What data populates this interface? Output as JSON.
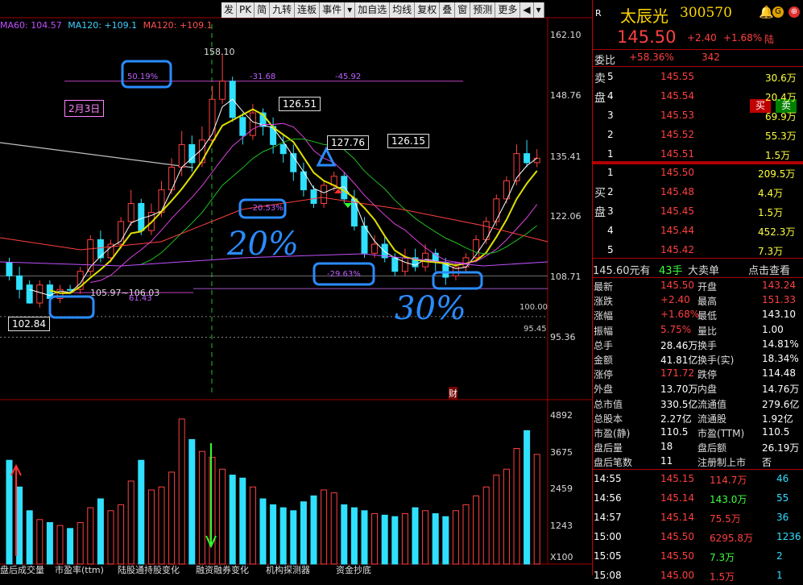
{
  "toolbar": {
    "items": [
      "发",
      "PK",
      "简",
      "九转",
      "连板",
      "事件",
      "▾",
      "加自选",
      "均线",
      "复权",
      "叠",
      "窗",
      "预测",
      "更多",
      "◀",
      "▾"
    ]
  },
  "ma_line": {
    "ma60": "MA60: 104.57",
    "ma120a": "MA120: +109.1",
    "ma120b": "MA120: +109.1"
  },
  "price_axis": [
    "162.10",
    "148.76",
    "135.41",
    "122.06",
    "108.71",
    "95.36"
  ],
  "vol_axis": [
    "4892",
    "3675",
    "2459",
    "1243",
    "X100"
  ],
  "levels": {
    "l100": "100.00",
    "l9545": "95.45"
  },
  "annotations": {
    "feb3": "2月3日",
    "p12651": "126.51",
    "p12776": "127.76",
    "p12615": "126.15",
    "p10284": "102.84",
    "p15810": "158.10",
    "range": "105.97~106.03",
    "pct5019": "50.19%",
    "pct2053": "-20.53%",
    "pct2963": "-29.63%",
    "pct3168": "-31.68",
    "pct4592": "-45.92",
    "pct6143": "61.43",
    "hand20": "20%",
    "hand30": "30%",
    "cai": "财"
  },
  "bottom_tabs": [
    "盘后成交量",
    "市盈率(ttm)",
    "陆股通持股变化",
    "融资融券变化",
    "机构探测器",
    "资金抄底"
  ],
  "quote": {
    "market": "R",
    "name": "太辰光",
    "code": "300570",
    "price": "145.50",
    "change": "+2.40",
    "pct": "+1.68%",
    "tag": "陆",
    "weibi_label": "委比",
    "weibi": "+58.36%",
    "weicha": "342",
    "buy": "买",
    "sell": "卖",
    "sell_side_label": "卖盘",
    "buy_side_label": "买盘",
    "asks": [
      {
        "n": "5",
        "p": "145.55",
        "v": "30.6万"
      },
      {
        "n": "4",
        "p": "145.54",
        "v": "20.4万"
      },
      {
        "n": "3",
        "p": "145.53",
        "v": "69.9万"
      },
      {
        "n": "2",
        "p": "145.52",
        "v": "55.3万"
      },
      {
        "n": "1",
        "p": "145.51",
        "v": "1.5万"
      }
    ],
    "bids": [
      {
        "n": "1",
        "p": "145.50",
        "v": "209.5万"
      },
      {
        "n": "2",
        "p": "145.48",
        "v": "4.4万"
      },
      {
        "n": "3",
        "p": "145.45",
        "v": "1.5万"
      },
      {
        "n": "4",
        "p": "145.44",
        "v": "452.3万"
      },
      {
        "n": "5",
        "p": "145.42",
        "v": "7.3万"
      }
    ],
    "bigorder": {
      "price": "145.60元有",
      "qty": "43手",
      "label": "大卖单",
      "link": "点击查看"
    },
    "stats": [
      [
        "最新",
        "145.50",
        "开盘",
        "143.24"
      ],
      [
        "涨跌",
        "+2.40",
        "最高",
        "151.33"
      ],
      [
        "涨幅",
        "+1.68%",
        "最低",
        "143.10"
      ],
      [
        "振幅",
        "5.75%",
        "量比",
        "1.00"
      ],
      [
        "总手",
        "28.46万",
        "换手",
        "14.81%"
      ],
      [
        "金额",
        "41.81亿",
        "换手(实)",
        "18.34%"
      ],
      [
        "涨停",
        "171.72",
        "跌停",
        "114.48"
      ],
      [
        "外盘",
        "13.70万",
        "内盘",
        "14.76万"
      ],
      [
        "总市值",
        "330.5亿",
        "流通值",
        "279.6亿"
      ],
      [
        "总股本",
        "2.27亿",
        "流通股",
        "1.92亿"
      ],
      [
        "市盈(静)",
        "110.5",
        "市盈(TTM)",
        "110.5"
      ],
      [
        "盘后量",
        "18",
        "盘后额",
        "26.19万"
      ],
      [
        "盘后笔数",
        "11",
        "注册制上市",
        "否"
      ]
    ],
    "ticks": [
      [
        "14:55",
        "145.15",
        "114.7万",
        "46"
      ],
      [
        "14:56",
        "145.14",
        "143.0万",
        "55"
      ],
      [
        "14:57",
        "145.14",
        "75.5万",
        "36"
      ],
      [
        "15:00",
        "145.50",
        "6295.8万",
        "1236"
      ],
      [
        "15:05",
        "145.50",
        "7.3万",
        "2"
      ],
      [
        "15:08",
        "145.00",
        "1.5万",
        "1"
      ]
    ]
  },
  "chart_data": {
    "type": "candlestick",
    "y_range": [
      95.36,
      162.1
    ],
    "candles": [
      [
        112,
        109,
        113,
        108
      ],
      [
        109,
        106,
        111,
        104
      ],
      [
        107,
        103,
        108,
        102.84
      ],
      [
        103,
        107,
        108,
        102
      ],
      [
        107,
        104,
        108,
        103
      ],
      [
        104,
        106,
        107,
        103
      ],
      [
        106,
        105.97,
        107,
        105
      ],
      [
        106,
        110,
        111,
        105
      ],
      [
        110,
        117,
        118,
        109
      ],
      [
        117,
        113,
        119,
        112
      ],
      [
        113,
        116,
        117,
        112
      ],
      [
        116,
        121,
        122,
        115
      ],
      [
        121,
        125,
        128,
        120
      ],
      [
        125,
        119,
        126,
        118
      ],
      [
        119,
        123,
        125,
        118
      ],
      [
        123,
        128,
        130,
        122
      ],
      [
        128,
        133,
        135,
        127
      ],
      [
        133,
        138,
        141,
        131
      ],
      [
        138,
        134,
        140,
        132
      ],
      [
        134,
        139,
        142,
        133
      ],
      [
        139,
        148,
        151,
        138
      ],
      [
        148,
        152,
        158.1,
        147
      ],
      [
        152,
        144,
        153,
        143
      ],
      [
        144,
        140,
        145,
        138
      ],
      [
        140,
        145,
        147,
        139
      ],
      [
        145,
        142,
        146,
        140
      ],
      [
        142,
        138,
        144,
        136
      ],
      [
        138,
        136,
        140,
        134
      ],
      [
        136,
        132,
        138,
        130
      ],
      [
        132,
        128,
        134,
        126.51
      ],
      [
        128,
        125,
        129,
        124
      ],
      [
        125,
        129,
        130,
        124
      ],
      [
        129,
        131,
        132,
        127.76
      ],
      [
        131,
        126,
        132,
        125
      ],
      [
        126,
        120,
        128,
        119
      ],
      [
        120,
        114,
        122,
        113
      ],
      [
        114,
        116,
        118,
        113
      ],
      [
        116,
        113,
        118,
        112
      ],
      [
        113,
        110,
        114,
        109
      ],
      [
        110,
        113,
        115,
        109
      ],
      [
        113,
        111,
        115,
        110
      ],
      [
        111,
        114,
        116,
        110
      ],
      [
        114,
        112,
        115,
        110
      ],
      [
        112,
        108.71,
        113,
        107
      ],
      [
        109,
        111,
        112,
        108
      ],
      [
        111,
        113,
        114,
        110
      ],
      [
        113,
        117,
        118,
        112
      ],
      [
        117,
        121,
        122,
        116
      ],
      [
        121,
        126,
        127,
        120
      ],
      [
        126,
        130,
        131,
        125
      ],
      [
        130,
        136,
        138,
        129
      ],
      [
        136,
        134,
        139,
        133
      ],
      [
        134,
        135,
        137,
        133
      ]
    ],
    "volume_range": [
      0,
      4892
    ],
    "volumes": [
      3500,
      2600,
      1800,
      1500,
      1400,
      1300,
      1200,
      1400,
      1900,
      2200,
      1800,
      2000,
      2800,
      3500,
      2500,
      2600,
      3100,
      4892,
      4200,
      3800,
      3600,
      3200,
      3000,
      2900,
      2600,
      2200,
      2000,
      1900,
      1800,
      2100,
      2300,
      2500,
      2400,
      2000,
      1900,
      1800,
      1700,
      1650,
      1600,
      1700,
      1900,
      1800,
      1700,
      1600,
      1800,
      2000,
      2300,
      2600,
      3000,
      3200,
      3900,
      4500,
      3700
    ]
  }
}
